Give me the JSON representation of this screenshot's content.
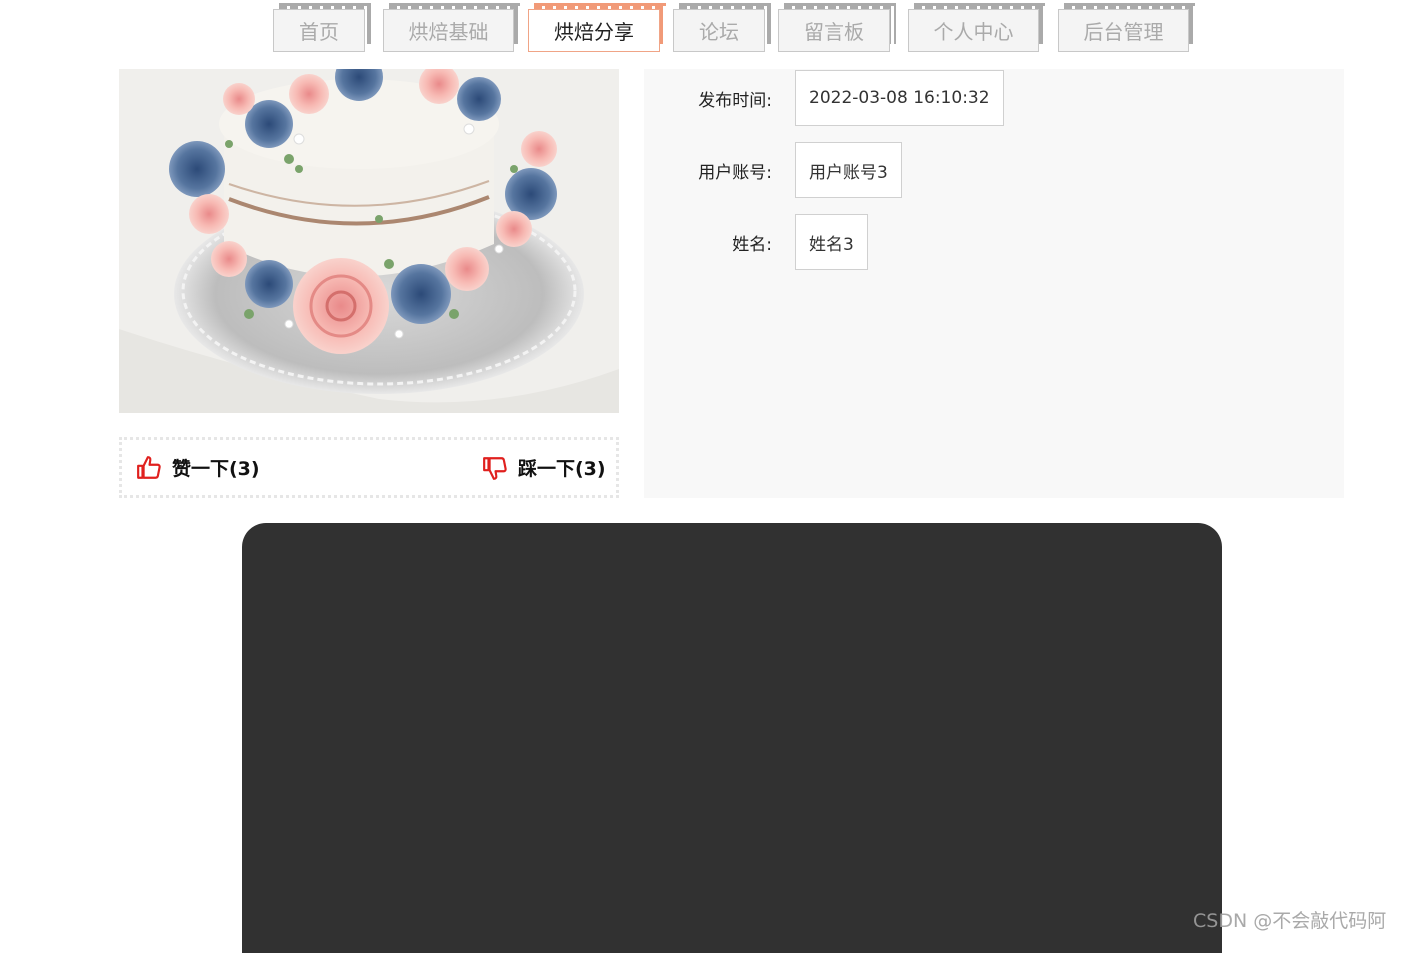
{
  "nav": {
    "tabs": [
      {
        "label": "首页",
        "active": false
      },
      {
        "label": "烘焙基础",
        "active": false
      },
      {
        "label": "烘焙分享",
        "active": true
      },
      {
        "label": "论坛",
        "active": false
      },
      {
        "label": "留言板",
        "active": false
      },
      {
        "label": "个人中心",
        "active": false
      },
      {
        "label": "后台管理",
        "active": false
      }
    ]
  },
  "votes": {
    "like_label": "赞一下(3)",
    "dislike_label": "踩一下(3)",
    "icon_color": "#e0201e"
  },
  "info": {
    "fields": [
      {
        "label": "发布时间:",
        "value": "2022-03-08 16:10:32"
      },
      {
        "label": "用户账号:",
        "value": "用户账号3"
      },
      {
        "label": "姓名:",
        "value": "姓名3"
      }
    ]
  },
  "colors": {
    "accent": "#f19a78",
    "panel_bg": "#f8f8f8",
    "dark_block": "#313131"
  },
  "watermark": "CSDN @不会敲代码阿"
}
